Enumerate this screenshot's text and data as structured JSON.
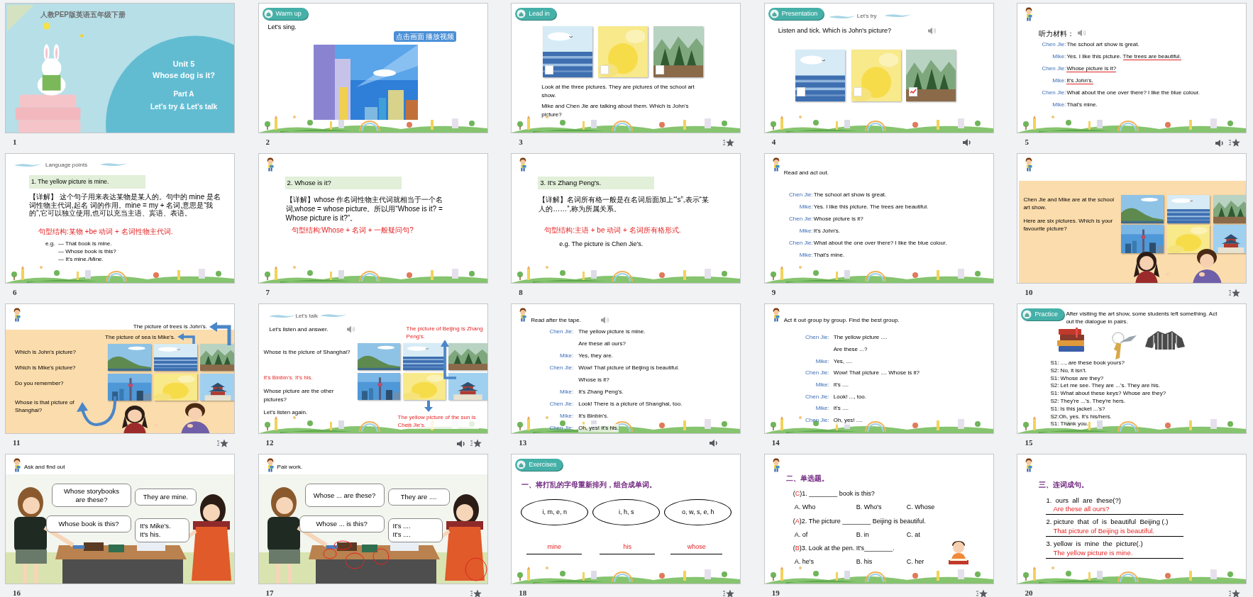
{
  "slides": [
    {
      "number": "1",
      "kind": "title",
      "audio": false,
      "animation": false,
      "series": "人教PEP版英语五年级下册",
      "title_lines": [
        "Unit 5",
        "Whose dog is it?"
      ],
      "subtitle_lines": [
        "Part A",
        "Let's try & Let's talk"
      ]
    },
    {
      "number": "2",
      "kind": "video",
      "audio": false,
      "animation": false,
      "section": "Warm up",
      "instruction": "Let's sing.",
      "play_button": "点击画面 播放视频"
    },
    {
      "number": "3",
      "kind": "paintings",
      "audio": false,
      "animation": true,
      "section": "Lead in",
      "pictures": [
        {
          "checked": false
        },
        {
          "checked": false
        },
        {
          "checked": false
        }
      ],
      "paragraphs": [
        "Look at the three pictures. They are pictures of the school art show.",
        "Mike and Chen Jie are talking about them. Which is John's picture?"
      ]
    },
    {
      "number": "4",
      "kind": "tick",
      "audio": true,
      "animation": false,
      "section": "Presentation",
      "heading": "Let's try",
      "instruction": "Listen and tick. Which is John's picture?",
      "pictures": [
        {
          "checked": false
        },
        {
          "checked": false
        },
        {
          "checked": true
        }
      ]
    },
    {
      "number": "5",
      "kind": "script",
      "audio": true,
      "animation": true,
      "heading": "听力材料：",
      "lines": [
        {
          "speaker": "Chen Jie:",
          "parts": [
            {
              "text": "The school art show is great.",
              "underlined": false
            }
          ]
        },
        {
          "speaker": "Mike:",
          "parts": [
            {
              "text": "Yes. I like this picture. ",
              "underlined": false
            },
            {
              "text": "The trees are beautiful.",
              "underlined": true
            }
          ]
        },
        {
          "speaker": "Chen Jie:",
          "parts": [
            {
              "text": "Whose picture is it?",
              "underlined": true
            }
          ]
        },
        {
          "speaker": "Mike:",
          "parts": [
            {
              "text": "It's John's.",
              "underlined": true
            }
          ]
        },
        {
          "speaker": "Chen Jie:",
          "parts": [
            {
              "text": "What about the one over there? I like the blue colour.",
              "underlined": false
            }
          ]
        },
        {
          "speaker": "Mike:",
          "parts": [
            {
              "text": "That's mine.",
              "underlined": false
            }
          ]
        }
      ]
    },
    {
      "number": "6",
      "kind": "language_points",
      "audio": false,
      "animation": false,
      "heading": "Language points",
      "point": "1. The yellow picture is mine.",
      "explanation": "【详解】 这个句子用来表达某物是某人的。句中的 mine 是名词性物主代词,起名 词的作用。mine = my + 名词,意思是“我的”,它可以独立使用,也可以充当主语、宾语、表语。",
      "pattern": "句型结构:某物 +be 动词 + 名词性物主代词.",
      "example_label": "e.g.",
      "examples": [
        "— That book is mine.",
        "— Whose book is this?",
        "— It's mine./Mine."
      ]
    },
    {
      "number": "7",
      "kind": "explanation",
      "audio": false,
      "animation": false,
      "point": "2. Whose is it?",
      "explanation": "【详解】whose 作名词性物主代词就相当于一个名词,whose = whose picture。所以用“Whose is it? = Whose picture is it?”。",
      "pattern": "句型结构:Whose + 名词 + 一般疑问句?"
    },
    {
      "number": "8",
      "kind": "explanation",
      "audio": false,
      "animation": false,
      "point": "3. It's Zhang Peng's.",
      "explanation": "【详解】名词所有格一般是在名词后面加上“'s”,表示“某人的……”,称为所属关系。",
      "pattern": "句型结构:主语 + be 动词 + 名词所有格形式.",
      "example": "e.g. The picture is Chen Jie's."
    },
    {
      "number": "9",
      "kind": "dialogue",
      "audio": false,
      "animation": false,
      "instruction": "Read and act out.",
      "lines": [
        {
          "speaker": "Chen Jie:",
          "text": "The school art show is great."
        },
        {
          "speaker": "Mike:",
          "text": "Yes. I like this picture. The trees are beautiful."
        },
        {
          "speaker": "Chen Jie:",
          "text": "Whose picture is it?"
        },
        {
          "speaker": "Mike:",
          "text": "It's John's."
        },
        {
          "speaker": "Chen Jie:",
          "text": "What about the one over there? I like the blue colour."
        },
        {
          "speaker": "Mike:",
          "text": "That's mine."
        }
      ]
    },
    {
      "number": "10",
      "kind": "gallery",
      "audio": false,
      "animation": true,
      "paragraphs": [
        "Chen Jie and Mike are at the school art show.",
        "Here are six pictures. Which is your favourite picture?"
      ]
    },
    {
      "number": "11",
      "kind": "gallery_questions",
      "audio": false,
      "animation": true,
      "notes": [
        "The picture of trees is John's.",
        "The picture of sea is Mike's."
      ],
      "questions": [
        "Which is John's picture?",
        "Which is Mike's picture?",
        "Do you remember?",
        "Whose is that picture of Shanghai?"
      ]
    },
    {
      "number": "12",
      "kind": "listen",
      "audio": true,
      "animation": true,
      "heading": "Let's talk",
      "instruction": "Let's listen and answer.",
      "prompts": [
        {
          "kind": "question",
          "text": "Whose is the picture of Shanghai?"
        },
        {
          "kind": "answer",
          "text": "It's Binbin's. It's his."
        },
        {
          "kind": "question",
          "text": "Whose picture are the other pictures?"
        },
        {
          "kind": "question",
          "text": "Let's listen again."
        }
      ],
      "callouts": [
        "The picture of Beijing is Zhang Peng's.",
        "The yellow picture of the sun is Chen Jie's."
      ]
    },
    {
      "number": "13",
      "kind": "read_along",
      "audio": true,
      "animation": false,
      "speaker_icon": true,
      "instruction": "Read after the tape.",
      "lines": [
        {
          "speaker": "Chen Jie:",
          "text": "The yellow picture is mine."
        },
        {
          "text": "Are these all ours?"
        },
        {
          "speaker": "Mike:",
          "text": "Yes, they are."
        },
        {
          "speaker": "Chen Jie:",
          "text": "Wow! That picture of Beijing is beautiful."
        },
        {
          "text": "Whose is it?"
        },
        {
          "speaker": "Mike:",
          "text": "It's Zhang Peng's."
        },
        {
          "speaker": "Chen Jie:",
          "text": "Look! There is a picture of Shanghai, too."
        },
        {
          "speaker": "Mike:",
          "text": "It's Binbin's."
        },
        {
          "speaker": "Chen Jie:",
          "text": "Oh, yes! It's his."
        }
      ]
    },
    {
      "number": "14",
      "kind": "read_along",
      "audio": false,
      "animation": false,
      "speaker_icon": false,
      "instruction": "Act it out group by group. Find the best group.",
      "lines": [
        {
          "speaker": "Chen Jie:",
          "text": "The yellow picture ...."
        },
        {
          "text": "Are these ...?"
        },
        {
          "speaker": "Mike:",
          "text": "Yes, ...."
        },
        {
          "speaker": "Chen Jie:",
          "text": "Wow! That picture .... Whose is it?"
        },
        {
          "speaker": "Mike:",
          "text": "It's ...."
        },
        {
          "speaker": "Chen Jie:",
          "text": "Look! ..., too."
        },
        {
          "speaker": "Mike:",
          "text": "It's ...."
        },
        {
          "speaker": "Chen Jie:",
          "text": "Oh, yes! ...."
        }
      ]
    },
    {
      "number": "15",
      "kind": "practice",
      "audio": false,
      "animation": false,
      "section": "Practice",
      "instruction": "After visiting the art show, some students left something. Act out the dialogue in pairs.",
      "lines": [
        "S1: ..., are these book yours?",
        "S2: No, it isn't.",
        "S1: Whose are they?",
        "S2: Let me see. They are ...'s. They are his.",
        "S1: What about these keys? Whose are they?",
        "S2: They're ...'s. They're hers.",
        "S1: Is this jacket ...'s?",
        "S2:Oh, yes. It's his/hers.",
        "S1: Thank you."
      ]
    },
    {
      "number": "16",
      "kind": "bubbles",
      "audio": false,
      "animation": false,
      "circled": false,
      "instruction": "Ask and find out",
      "bubbles": [
        "Whose storybooks\nare these?",
        "They are mine.",
        "Whose book is this?",
        "It's Mike's.\nIt's his."
      ]
    },
    {
      "number": "17",
      "kind": "bubbles",
      "audio": false,
      "animation": true,
      "circled": true,
      "instruction": "Pair work.",
      "bubbles": [
        "Whose ... are these?",
        "They are ....",
        "Whose ... is this?",
        "It's ....\nIt's ...."
      ]
    },
    {
      "number": "18",
      "kind": "unscramble",
      "audio": false,
      "animation": true,
      "section": "Exercises",
      "heading": "一、将打乱的字母重新排列，组合成单词。",
      "items": [
        {
          "letters": "i, m, e, n",
          "answer": "mine"
        },
        {
          "letters": "i, h, s",
          "answer": "his"
        },
        {
          "letters": "o, w, s, e, h",
          "answer": "whose"
        }
      ]
    },
    {
      "number": "19",
      "kind": "choice",
      "audio": false,
      "animation": true,
      "heading": "二、单选题。",
      "questions": [
        {
          "open": "(",
          "answer": "C",
          "text": ")1. ________ book is this?",
          "options": [
            "A. Who",
            "B. Who's",
            "C. Whose"
          ]
        },
        {
          "open": "(",
          "answer": "A",
          "text": ")2. The picture ________ Beijing is beautiful.",
          "options": [
            "A. of",
            "B. in",
            "C. at"
          ]
        },
        {
          "open": "(",
          "answer": "B",
          "text": ")3. Look at the pen. It's________.",
          "options": [
            "A. he's",
            "B. his",
            "C. her"
          ]
        }
      ]
    },
    {
      "number": "20",
      "kind": "sentences",
      "audio": false,
      "animation": true,
      "heading": "三、连词成句。",
      "items": [
        {
          "words": "1.  ours  all  are  these(?)",
          "answer": "Are these all ours?"
        },
        {
          "words": "2. picture  that  of  is  beautiful  Beijing (.)",
          "answer": "That picture of Beijing is beautiful."
        },
        {
          "words": "3. yellow  is  mine  the  picture(.)",
          "answer": "The yellow picture is mine."
        }
      ]
    }
  ]
}
